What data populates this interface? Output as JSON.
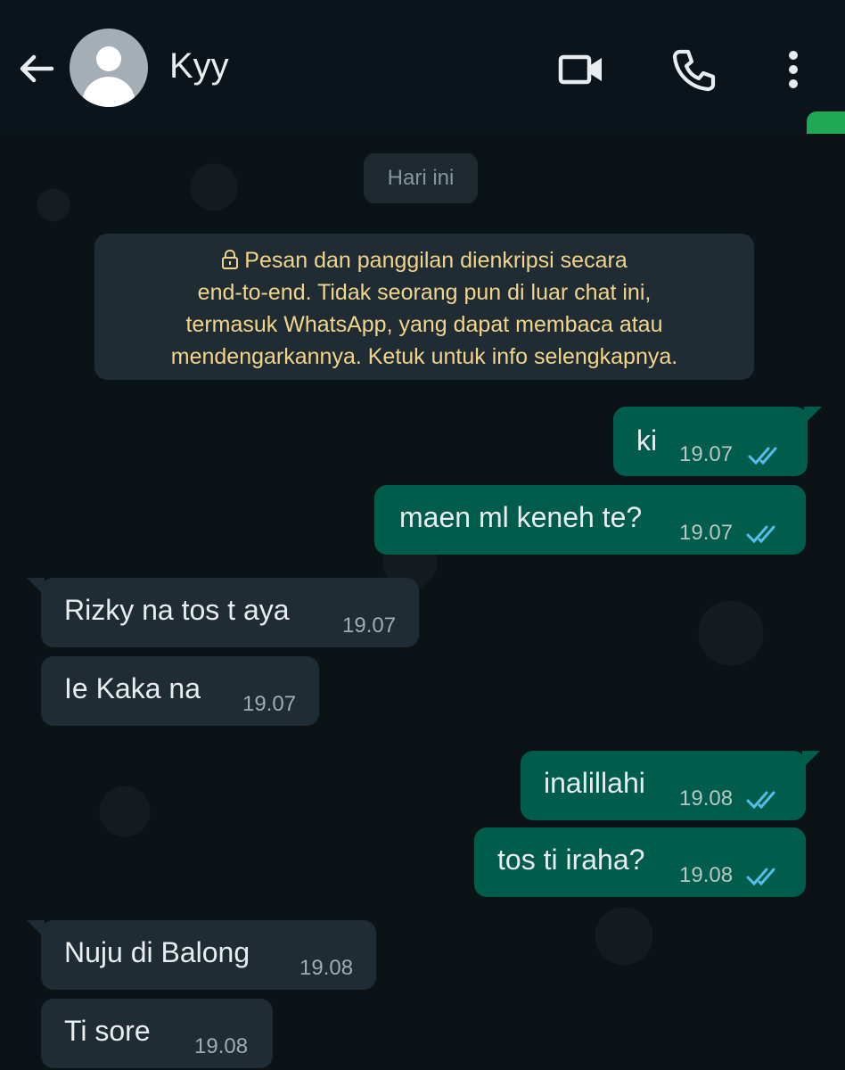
{
  "header": {
    "contact_name": "Kyy",
    "icons": [
      "back-arrow-icon",
      "avatar-icon",
      "video-call-icon",
      "phone-call-icon",
      "more-options-icon"
    ]
  },
  "chat": {
    "date_chip": "Hari ini",
    "encryption_notice": {
      "line1": "Pesan dan panggilan dienkripsi secara",
      "line2": "end-to-end. Tidak seorang pun di luar chat ini,",
      "line3": "termasuk WhatsApp, yang dapat membaca atau",
      "line4": "mendengarkannya. Ketuk untuk info selengkapnya."
    },
    "messages": [
      {
        "direction": "outgoing",
        "text": "ki",
        "time": "19.07",
        "status": "read"
      },
      {
        "direction": "outgoing",
        "text": "maen ml keneh te?",
        "time": "19.07",
        "status": "read"
      },
      {
        "direction": "incoming",
        "text": "Rizky na tos t aya",
        "time": "19.07"
      },
      {
        "direction": "incoming",
        "text": "Ie Kaka na",
        "time": "19.07"
      },
      {
        "direction": "outgoing",
        "text": "inalillahi",
        "time": "19.08",
        "status": "read"
      },
      {
        "direction": "outgoing",
        "text": "tos ti iraha?",
        "time": "19.08",
        "status": "read"
      },
      {
        "direction": "incoming",
        "text": "Nuju di Balong",
        "time": "19.08"
      },
      {
        "direction": "incoming",
        "text": "Ti sore",
        "time": "19.08"
      }
    ]
  },
  "colors": {
    "background": "#0b141a",
    "outgoing_bubble": "#005c4b",
    "incoming_bubble": "#1f2c33",
    "read_ticks": "#53bdeb",
    "notice_text": "#f3d48b"
  }
}
